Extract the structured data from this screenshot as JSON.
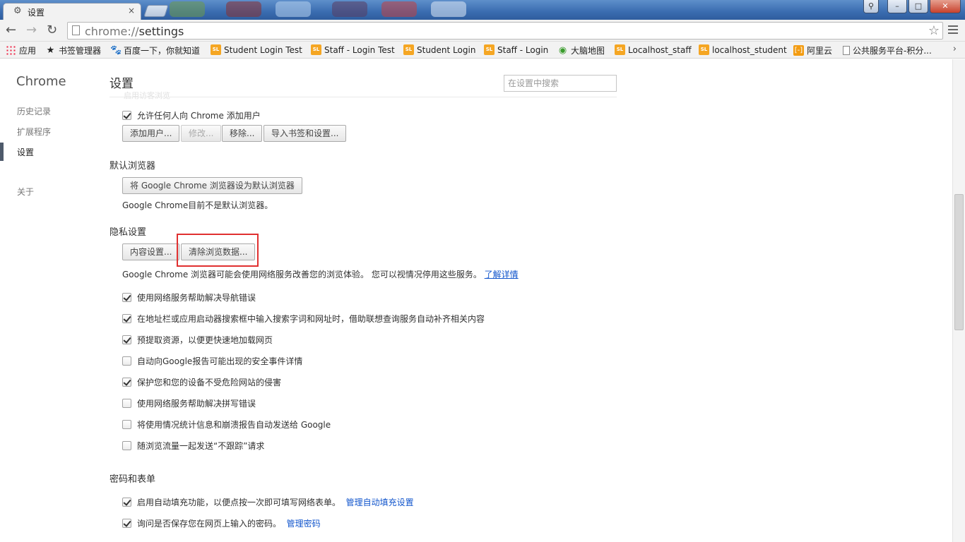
{
  "window": {
    "tab_icon": "gear-icon",
    "tab_title": "设置",
    "tab_close": "×",
    "min_label": "–",
    "max_label": "□",
    "close_label": "✕",
    "user_label": "👤"
  },
  "toolbar": {
    "back": "←",
    "forward": "→",
    "reload": "↻",
    "url_scheme": "chrome://",
    "url_path": "settings",
    "star": "☆"
  },
  "bookmarks": [
    {
      "label": "应用",
      "icon": "apps-icon"
    },
    {
      "label": "书签管理器",
      "icon": "star-icon"
    },
    {
      "label": "百度一下，你就知道",
      "icon": "baidu-icon"
    },
    {
      "label": "Student Login Test",
      "icon": "sl-icon"
    },
    {
      "label": "Staff - Login Test",
      "icon": "sl-icon"
    },
    {
      "label": "Student Login",
      "icon": "sl-icon"
    },
    {
      "label": "Staff - Login",
      "icon": "sl-icon"
    },
    {
      "label": "大脑地图",
      "icon": "map-icon"
    },
    {
      "label": "Localhost_staff",
      "icon": "sl-icon"
    },
    {
      "label": "localhost_student",
      "icon": "sl-icon"
    },
    {
      "label": "阿里云",
      "icon": "aliyun-icon"
    },
    {
      "label": "公共服务平台-积分...",
      "icon": "document-icon"
    }
  ],
  "sidebar": {
    "title": "Chrome",
    "items": [
      "历史记录",
      "扩展程序",
      "设置",
      "关于"
    ]
  },
  "page": {
    "title": "设置",
    "search_placeholder": "在设置中搜索",
    "faded_text": "启用访客浏览"
  },
  "users": {
    "allow_add": "允许任何人向 Chrome 添加用户",
    "add_user": "添加用户...",
    "edit": "修改...",
    "remove": "移除...",
    "import": "导入书签和设置..."
  },
  "default_browser": {
    "title": "默认浏览器",
    "button": "将 Google Chrome 浏览器设为默认浏览器",
    "status": "Google Chrome目前不是默认浏览器。"
  },
  "privacy": {
    "title": "隐私设置",
    "content_settings": "内容设置...",
    "clear_data": "清除浏览数据...",
    "description": "Google Chrome 浏览器可能会使用网络服务改善您的浏览体验。 您可以视情况停用这些服务。",
    "learn_more": "了解详情",
    "options": [
      {
        "label": "使用网络服务帮助解决导航错误",
        "checked": true
      },
      {
        "label": "在地址栏或应用启动器搜索框中输入搜索字词和网址时，借助联想查询服务自动补齐相关内容",
        "checked": true
      },
      {
        "label": "预提取资源，以便更快速地加载网页",
        "checked": true
      },
      {
        "label": "自动向Google报告可能出现的安全事件详情",
        "checked": false
      },
      {
        "label": "保护您和您的设备不受危险网站的侵害",
        "checked": true
      },
      {
        "label": "使用网络服务帮助解决拼写错误",
        "checked": false
      },
      {
        "label": "将使用情况统计信息和崩溃报告自动发送给 Google",
        "checked": false
      },
      {
        "label": "随浏览流量一起发送“不跟踪”请求",
        "checked": false
      }
    ]
  },
  "passwords": {
    "title": "密码和表单",
    "autofill": "启用自动填充功能，以便点按一次即可填写网络表单。",
    "autofill_link": "管理自动填充设置",
    "save_passwords": "询问是否保存您在网页上输入的密码。",
    "passwords_link": "管理密码"
  },
  "colors": {
    "highlight": "#e03030",
    "link": "#1155cc"
  }
}
